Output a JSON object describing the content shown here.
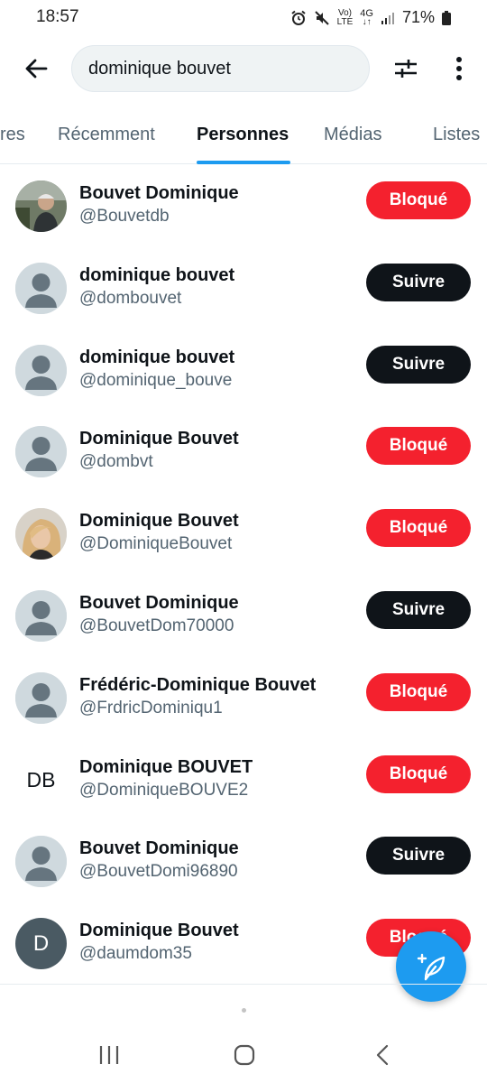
{
  "status_bar": {
    "time": "18:57",
    "battery": "71%",
    "icons": [
      "alarm-icon",
      "mute-icon",
      "volte-icon",
      "4g-icon",
      "signal-icon",
      "battery-icon"
    ],
    "network_top": "Vo)",
    "network_bottom": "LTE",
    "data_type": "4G"
  },
  "search": {
    "query": "dominique bouvet",
    "back_icon": "arrow-left-icon",
    "filter_icon": "sliders-icon",
    "more_icon": "more-vertical-icon"
  },
  "tabs": [
    {
      "label": "res",
      "active": false
    },
    {
      "label": "Récemment",
      "active": false
    },
    {
      "label": "Personnes",
      "active": true
    },
    {
      "label": "Médias",
      "active": false
    },
    {
      "label": "Listes",
      "active": false
    }
  ],
  "users": [
    {
      "name": "Bouvet Dominique",
      "handle": "@Bouvetdb",
      "avatar": "photo-man",
      "action": "Bloqué"
    },
    {
      "name": "dominique bouvet",
      "handle": "@dombouvet",
      "avatar": "default",
      "action": "Suivre"
    },
    {
      "name": "dominique bouvet",
      "handle": "@dominique_bouve",
      "avatar": "default",
      "action": "Suivre"
    },
    {
      "name": "Dominique Bouvet",
      "handle": "@dombvt",
      "avatar": "default",
      "action": "Bloqué"
    },
    {
      "name": "Dominique Bouvet",
      "handle": "@DominiqueBouvet",
      "avatar": "photo-woman",
      "action": "Bloqué"
    },
    {
      "name": "Bouvet Dominique",
      "handle": "@BouvetDom70000",
      "avatar": "default",
      "action": "Suivre"
    },
    {
      "name": "Frédéric-Dominique Bouvet",
      "handle": "@FrdricDominiqu1",
      "avatar": "default",
      "action": "Bloqué"
    },
    {
      "name": "Dominique BOUVET",
      "handle": "@DominiqueBOUVE2",
      "avatar": "initials",
      "avatar_text": "DB",
      "action": "Bloqué"
    },
    {
      "name": "Bouvet Dominique",
      "handle": "@BouvetDomi96890",
      "avatar": "default",
      "action": "Suivre"
    },
    {
      "name": "Dominique Bouvet",
      "handle": "@daumdom35",
      "avatar": "initial",
      "avatar_text": "D",
      "action": "Bloqué"
    }
  ],
  "fab": {
    "icon": "compose-feather-icon"
  },
  "colors": {
    "accent": "#1d9bf0",
    "blocked": "#f4212e",
    "follow": "#0f1419",
    "secondary_text": "#536471"
  },
  "android_nav": [
    "recents-icon",
    "home-icon",
    "back-icon"
  ]
}
